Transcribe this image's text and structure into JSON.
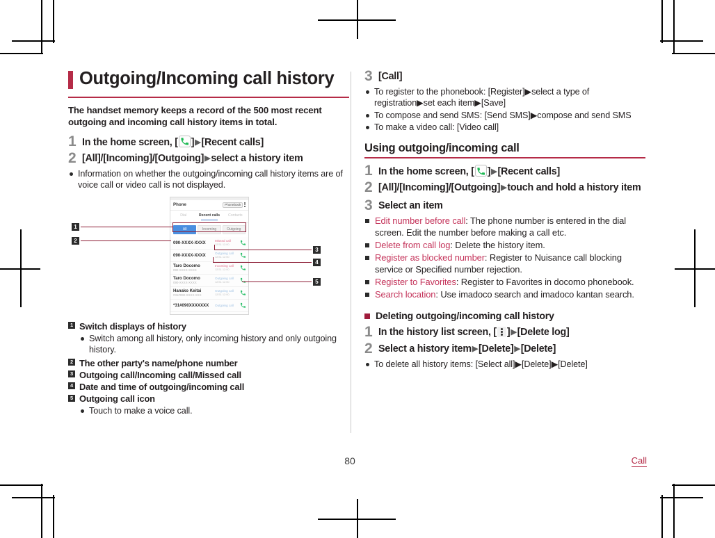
{
  "page": {
    "number": "80",
    "chapter": "Call"
  },
  "left": {
    "title": "Outgoing/Incoming call history",
    "lead": "The handset memory keeps a record of the 500 most recent outgoing and incoming call history items in total.",
    "steps": [
      {
        "num": "1",
        "pre": "In the home screen, [",
        "icon": "phone-icon",
        "mid": "]",
        "arrow": "▶",
        "post": "[Recent calls]"
      },
      {
        "num": "2",
        "pre": "[All]/[Incoming]/[Outgoing]",
        "arrow": "▶",
        "post": "select a history item",
        "bullets": [
          "Information on whether the outgoing/incoming call history items are of voice call or video call is not displayed."
        ]
      }
    ],
    "figure": {
      "phone": {
        "app_title": "Phone",
        "phonebook_chip": "Phonebook",
        "kebab": "more-options-icon",
        "tabs": [
          "Dial",
          "Recent calls",
          "Contacts"
        ],
        "active_tab_index": 1,
        "segments": [
          "All",
          "Incoming",
          "Outgoing"
        ],
        "active_segment_index": 0,
        "rows": [
          {
            "name": "090-XXXX-XXXX",
            "sub": "",
            "status": "Missed call",
            "status_type": "miss",
            "time": "12/31 12:00",
            "icon": "call-icon"
          },
          {
            "name": "090-XXXX-XXXX",
            "sub": "",
            "status": "Outgoing call",
            "status_type": "out",
            "time": "12/31 12:00",
            "icon": "call-icon"
          },
          {
            "name": "Taro Docomo",
            "sub": "090-XXXX-XXXX",
            "status": "Incoming call",
            "status_type": "miss",
            "time": "12/31 12:00",
            "icon": "call-icon"
          },
          {
            "name": "Taro Docomo",
            "sub": "090-XXXX-XXXX",
            "status": "Outgoing call",
            "status_type": "out",
            "time": "12/31 12:00",
            "icon": "call-icon"
          },
          {
            "name": "Hanako Keitai",
            "sub": "#31#090-XXXX-XXX",
            "status": "Outgoing call",
            "status_type": "out",
            "time": "12/31 12:00",
            "icon": "call-icon"
          },
          {
            "name": "*31#090XXXXXXX",
            "sub": "",
            "status": "Outgoing call",
            "status_type": "out",
            "time": "",
            "icon": "call-icon"
          }
        ]
      },
      "callouts": [
        "1",
        "2",
        "3",
        "4",
        "5"
      ]
    },
    "keyed": [
      {
        "key": "1",
        "label": "Switch displays of history",
        "bullets": [
          "Switch among all history, only incoming history and only outgoing history."
        ]
      },
      {
        "key": "2",
        "label": "The other party's name/phone number",
        "bullets": []
      },
      {
        "key": "3",
        "label": "Outgoing call/Incoming call/Missed call",
        "bullets": []
      },
      {
        "key": "4",
        "label": "Date and time of outgoing/incoming call",
        "bullets": []
      },
      {
        "key": "5",
        "label": "Outgoing call icon",
        "bullets": [
          "Touch to make a voice call."
        ]
      }
    ]
  },
  "right": {
    "step3": {
      "num": "3",
      "title": "[Call]",
      "bullets": [
        "To register to the phonebook: [Register]▶select a type of registration▶set each item▶[Save]",
        "To compose and send SMS: [Send SMS]▶compose and send SMS",
        "To make a video call: [Video call]"
      ]
    },
    "subheading": "Using outgoing/incoming call",
    "steps": [
      {
        "num": "1",
        "pre": "In the home screen, [",
        "icon": "phone-icon",
        "mid": "]",
        "arrow": "▶",
        "post": "[Recent calls]"
      },
      {
        "num": "2",
        "pre": "[All]/[Incoming]/[Outgoing]",
        "arrow": "▶",
        "post": "touch and hold a history item"
      },
      {
        "num": "3",
        "title": "Select an item",
        "items": [
          {
            "kw": "Edit number before call",
            "text": ": The phone number is entered in the dial screen. Edit the number before making a call etc."
          },
          {
            "kw": "Delete from call log",
            "text": ": Delete the history item."
          },
          {
            "kw": "Register as blocked number",
            "text": ": Register to Nuisance call blocking service or Specified number rejection."
          },
          {
            "kw": "Register to Favorites",
            "text": ": Register to Favorites in docomo phonebook."
          },
          {
            "kw": "Search location",
            "text": ": Use imadoco search and imadoco kantan search."
          }
        ]
      }
    ],
    "delete_heading": "Deleting outgoing/incoming call history",
    "delete_steps": [
      {
        "num": "1",
        "pre": "In the history list screen, [",
        "icon": "kebab-menu-icon",
        "mid": "]",
        "arrow": "▶",
        "post": "[Delete log]"
      },
      {
        "num": "2",
        "pre": "Select a history item",
        "arrow": "▶",
        "mid2": "[Delete]",
        "post": "[Delete]",
        "bullets": [
          "To delete all history items: [Select all]▶[Delete]▶[Delete]"
        ]
      }
    ]
  },
  "colors": {
    "accent": "#b52b47",
    "keyword": "#c4335a",
    "marker": "#a01c3c",
    "step_num": "#8a8a8a"
  }
}
